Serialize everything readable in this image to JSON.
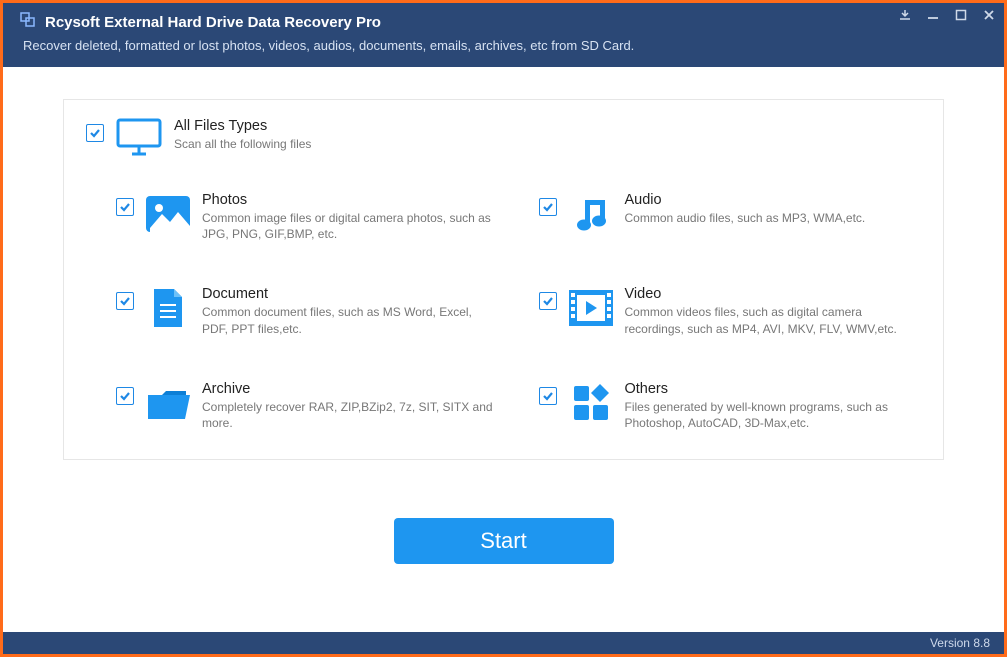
{
  "header": {
    "title": "Rcysoft External Hard Drive Data Recovery Pro",
    "subtitle": "Recover deleted, formatted or lost photos, videos, audios, documents, emails, archives, etc from SD Card."
  },
  "all": {
    "title": "All Files Types",
    "desc": "Scan all the following files"
  },
  "categories": {
    "photos": {
      "title": "Photos",
      "desc": "Common image files or digital camera photos, such as JPG, PNG, GIF,BMP, etc."
    },
    "audio": {
      "title": "Audio",
      "desc": "Common audio files, such as MP3, WMA,etc."
    },
    "document": {
      "title": "Document",
      "desc": "Common document files, such as MS Word, Excel, PDF, PPT files,etc."
    },
    "video": {
      "title": "Video",
      "desc": "Common videos files, such as digital camera recordings, such as MP4, AVI, MKV, FLV, WMV,etc."
    },
    "archive": {
      "title": "Archive",
      "desc": "Completely recover RAR, ZIP,BZip2, 7z, SIT, SITX and more."
    },
    "others": {
      "title": "Others",
      "desc": "Files generated by well-known programs, such as Photoshop, AutoCAD, 3D-Max,etc."
    }
  },
  "buttons": {
    "start": "Start"
  },
  "status": {
    "version": "Version 8.8"
  },
  "colors": {
    "accent": "#1e96f0",
    "header": "#2b4876",
    "border": "#ff6b1a"
  }
}
